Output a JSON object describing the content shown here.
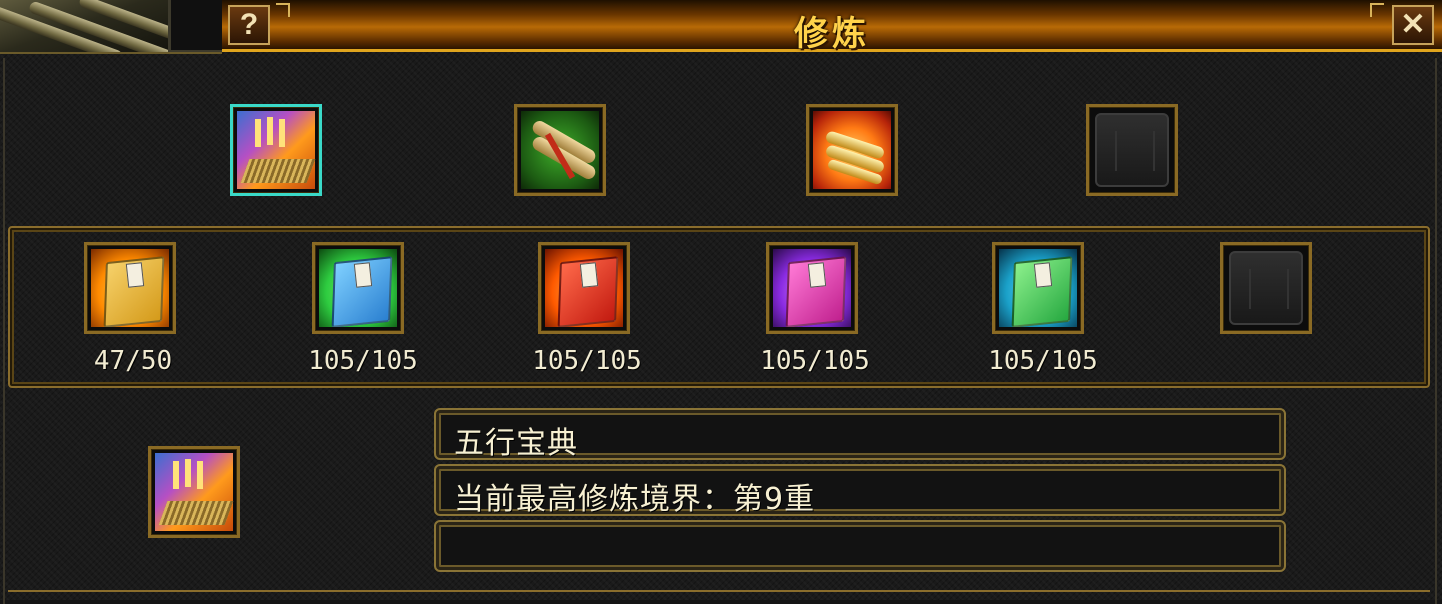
{
  "window": {
    "title": "修炼"
  },
  "titlebar": {
    "help_label": "?",
    "close_label": "✕"
  },
  "icons": {
    "help": "question-mark-icon",
    "close": "close-icon",
    "empty": "empty-slot-icon"
  },
  "manuals": [
    {
      "name": "book-fire-stripes",
      "selected": true
    },
    {
      "name": "scrolls-green",
      "selected": false
    },
    {
      "name": "golden-scrolls-fire",
      "selected": false
    },
    {
      "name": "empty",
      "selected": false
    }
  ],
  "books": [
    {
      "count": "47/50",
      "color": "#e7b72a",
      "glow": "#ff8a00"
    },
    {
      "count": "105/105",
      "color": "#3aa8e8",
      "glow": "#2ecc40"
    },
    {
      "count": "105/105",
      "color": "#e23b22",
      "glow": "#ff6a00"
    },
    {
      "count": "105/105",
      "color": "#e33ba8",
      "glow": "#8a2be2"
    },
    {
      "count": "105/105",
      "color": "#38c45a",
      "glow": "#1aa0c8"
    },
    {
      "count": "",
      "color": "",
      "glow": ""
    }
  ],
  "info": {
    "name": "五行宝典",
    "realm": "当前最高修炼境界：第9重",
    "extra": ""
  },
  "colors": {
    "accent_gold": "#e0a51e",
    "title_text": "#ffd24a",
    "selected_border": "#3ad9c8"
  }
}
